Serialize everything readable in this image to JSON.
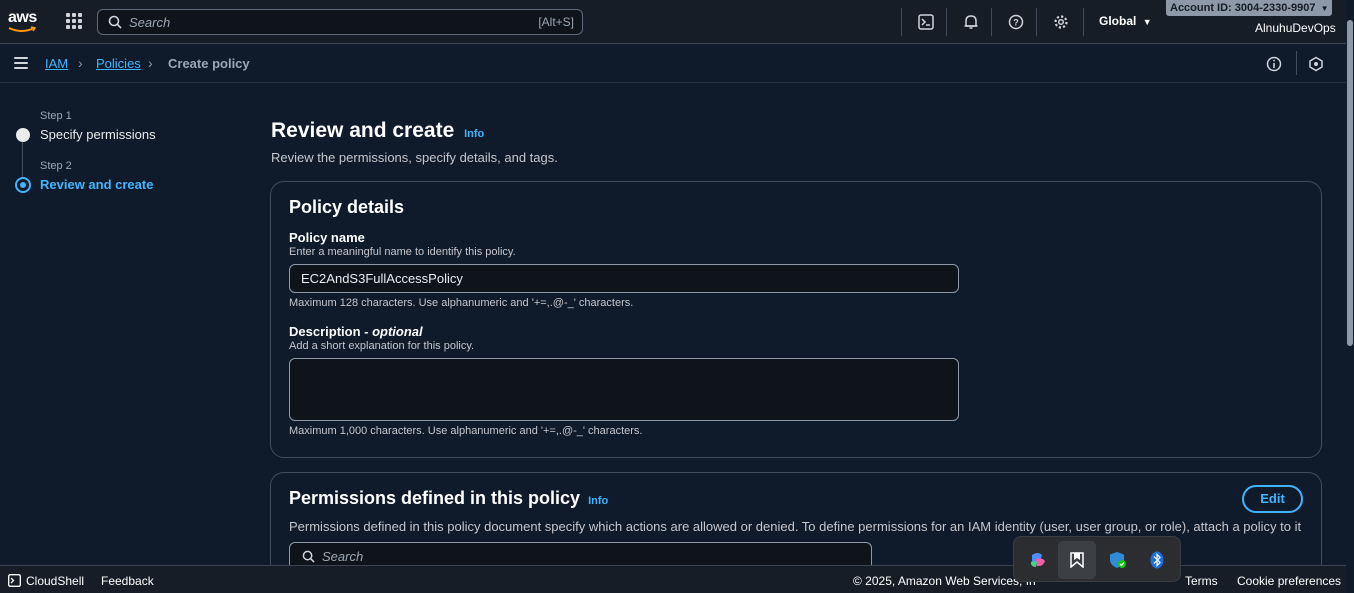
{
  "topnav": {
    "logo_text": "aws",
    "search_placeholder": "Search",
    "search_shortcut": "[Alt+S]",
    "region": "Global",
    "account_id": "Account ID: 3004-2330-9907",
    "user": "AlnuhuDevOps",
    "icons": [
      "services-grid-icon",
      "cloudshell-icon",
      "bell-icon",
      "help-icon",
      "gear-icon"
    ]
  },
  "breadcrumb": {
    "items": [
      "IAM",
      "Policies",
      "Create policy"
    ]
  },
  "stepper": {
    "steps": [
      {
        "label": "Step 1",
        "title": "Specify permissions"
      },
      {
        "label": "Step 2",
        "title": "Review and create"
      }
    ]
  },
  "main": {
    "title": "Review and create",
    "info": "Info",
    "subtitle": "Review the permissions, specify details, and tags."
  },
  "policy_details": {
    "title": "Policy details",
    "name_label": "Policy name",
    "name_desc": "Enter a meaningful name to identify this policy.",
    "name_value": "EC2AndS3FullAccessPolicy",
    "name_hint": "Maximum 128 characters. Use alphanumeric and '+=,.@-_' characters.",
    "desc_label": "Description",
    "desc_optional": " - optional",
    "desc_desc": "Add a short explanation for this policy.",
    "desc_value": "",
    "desc_hint": "Maximum 1,000 characters. Use alphanumeric and '+=,.@-_' characters."
  },
  "permissions": {
    "title": "Permissions defined in this policy",
    "info": "Info",
    "edit_label": "Edit",
    "desc": "Permissions defined in this policy document specify which actions are allowed or denied. To define permissions for an IAM identity (user, user group, or role), attach a policy to it",
    "search_placeholder": "Search"
  },
  "footer": {
    "cloudshell": "CloudShell",
    "feedback": "Feedback",
    "copyright": "© 2025, Amazon Web Services, In",
    "terms": "Terms",
    "cookie": "Cookie preferences"
  }
}
